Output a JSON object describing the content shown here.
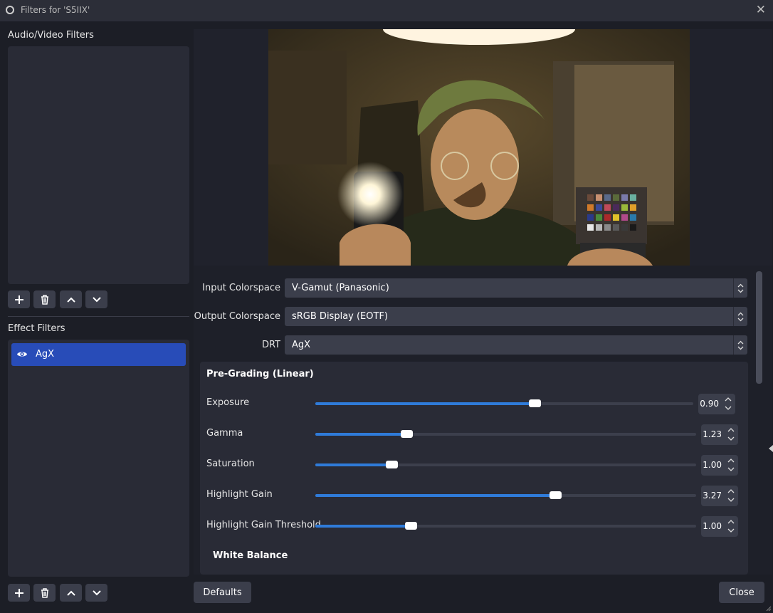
{
  "window": {
    "title": "Filters for 'S5IIX'",
    "close_glyph": "✕"
  },
  "audio_video": {
    "label": "Audio/Video Filters"
  },
  "effect": {
    "label": "Effect Filters",
    "items": [
      {
        "label": "AgX",
        "enabled": true
      }
    ]
  },
  "toolbar_icons": [
    "add-icon",
    "trash-icon",
    "move-up-icon",
    "move-down-icon"
  ],
  "properties": {
    "input_colorspace": {
      "label": "Input Colorspace",
      "value": "V-Gamut (Panasonic)"
    },
    "output_colorspace": {
      "label": "Output Colorspace",
      "value": "sRGB Display (EOTF)"
    },
    "drt": {
      "label": "DRT",
      "value": "AgX"
    },
    "pre_grading": {
      "title": "Pre-Grading (Linear)",
      "sliders": [
        {
          "label": "Exposure",
          "value": "0.90",
          "fraction": 0.58
        },
        {
          "label": "Gamma",
          "value": "1.23",
          "fraction": 0.24
        },
        {
          "label": "Saturation",
          "value": "1.00",
          "fraction": 0.2
        },
        {
          "label": "Highlight Gain",
          "value": "3.27",
          "fraction": 0.63
        },
        {
          "label": "Highlight Gain Threshold",
          "value": "1.00",
          "fraction": 0.25
        }
      ]
    },
    "white_balance": {
      "title": "White Balance"
    }
  },
  "buttons": {
    "defaults": "Defaults",
    "close": "Close"
  },
  "colors": {
    "accent": "#2f7bd9",
    "selection": "#284cb8",
    "background": "#1c1e26",
    "panel": "#292b36"
  }
}
